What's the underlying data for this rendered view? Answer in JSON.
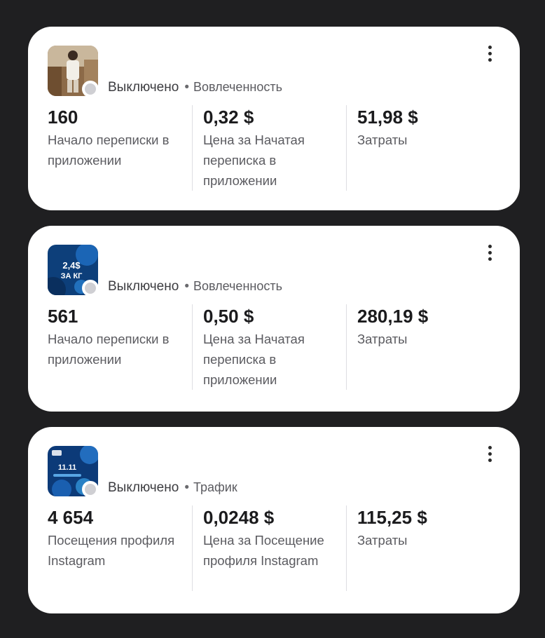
{
  "campaigns": [
    {
      "status": "Выключено",
      "objective": "Вовлеченность",
      "metrics": [
        {
          "value": "160",
          "label": "Начало переписки в приложении"
        },
        {
          "value": "0,32 $",
          "label": "Цена за Начатая переписка в приложении"
        },
        {
          "value": "51,98 $",
          "label": "Затраты"
        }
      ]
    },
    {
      "status": "Выключено",
      "objective": "Вовлеченность",
      "thumb_text": [
        "2,4$",
        "ЗА КГ"
      ],
      "metrics": [
        {
          "value": "561",
          "label": "Начало переписки в приложении"
        },
        {
          "value": "0,50 $",
          "label": "Цена за Начатая переписка в приложении"
        },
        {
          "value": "280,19 $",
          "label": "Затраты"
        }
      ]
    },
    {
      "status": "Выключено",
      "objective": "Трафик",
      "thumb_text": [
        "11.11"
      ],
      "metrics": [
        {
          "value": "4 654",
          "label": "Посещения профиля Instagram"
        },
        {
          "value": "0,0248 $",
          "label": "Цена за Посещение профиля Instagram"
        },
        {
          "value": "115,25 $",
          "label": "Затраты"
        }
      ]
    }
  ],
  "icons": {
    "status_dot": "status-dot-icon",
    "menu": "more-vertical-icon"
  },
  "colors": {
    "background": "#1f1f21",
    "card": "#ffffff",
    "status_dot": "#cfcfd3"
  }
}
